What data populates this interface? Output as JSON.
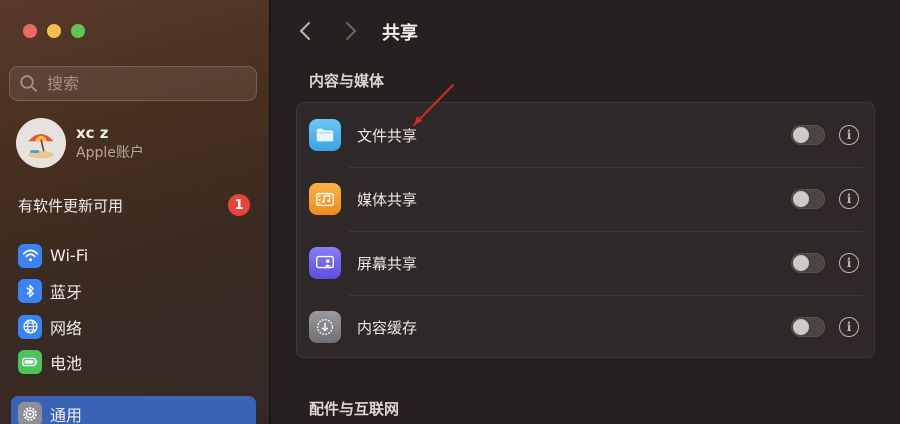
{
  "sidebar": {
    "search": {
      "placeholder": "搜索"
    },
    "account": {
      "name": "xc z",
      "subtitle": "Apple账户"
    },
    "update": {
      "label": "有软件更新可用",
      "count": "1"
    },
    "items": [
      {
        "label": "Wi-Fi",
        "icon": "wifi-icon",
        "color": "#3a82f7"
      },
      {
        "label": "蓝牙",
        "icon": "bluetooth-icon",
        "color": "#3a82f7"
      },
      {
        "label": "网络",
        "icon": "globe-icon",
        "color": "#3a82f7"
      },
      {
        "label": "电池",
        "icon": "battery-icon",
        "color": "#4cc35a"
      },
      {
        "label": "通用",
        "icon": "gear-icon",
        "color": "#8e8e93",
        "selected": true
      }
    ]
  },
  "main": {
    "title": "共享",
    "section1": {
      "title": "内容与媒体",
      "rows": [
        {
          "label": "文件共享",
          "icon": "folder-icon",
          "enabled": false
        },
        {
          "label": "媒体共享",
          "icon": "media-icon",
          "enabled": false
        },
        {
          "label": "屏幕共享",
          "icon": "screen-share-icon",
          "enabled": false
        },
        {
          "label": "内容缓存",
          "icon": "download-icon",
          "enabled": false
        }
      ]
    },
    "section2": {
      "title": "配件与互联网"
    },
    "info_glyph": "i"
  },
  "colors": {
    "accent": "#3b63b5",
    "badge": "#e9443a",
    "annotation": "#d8262a"
  }
}
